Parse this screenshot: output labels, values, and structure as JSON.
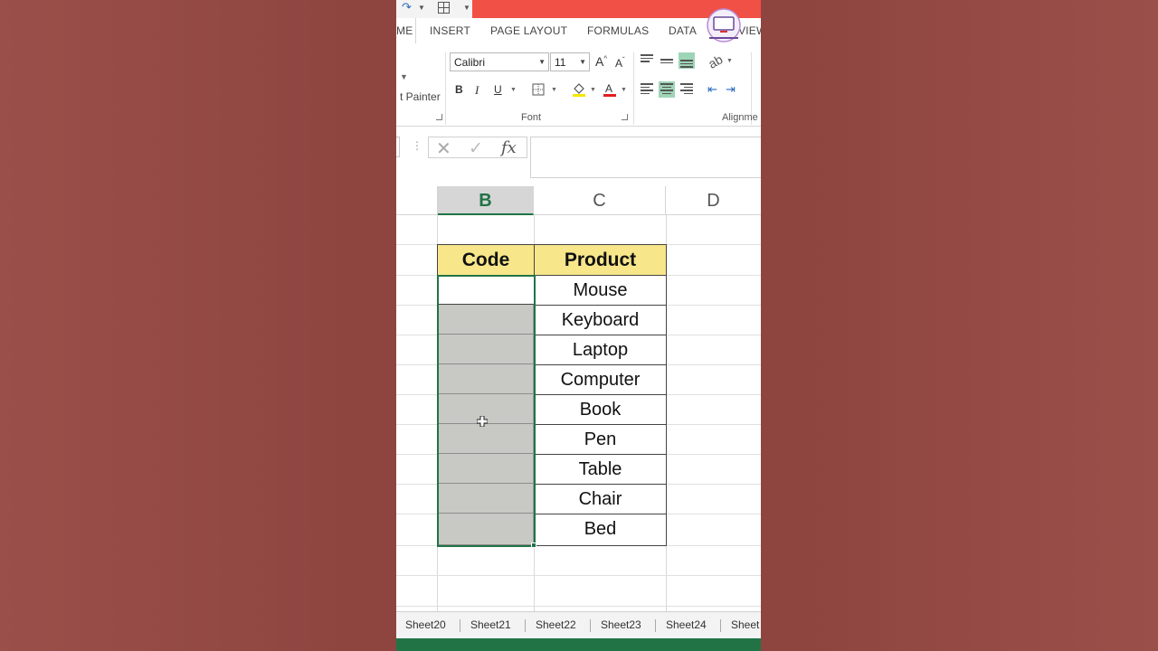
{
  "ribbon_tabs": [
    "ME",
    "INSERT",
    "PAGE LAYOUT",
    "FORMULAS",
    "DATA",
    "REVIEW"
  ],
  "clipboard": {
    "format_painter_label": "t Painter"
  },
  "font": {
    "name": "Calibri",
    "size": "11",
    "bold": "B",
    "italic": "I",
    "underline": "U",
    "grow": "A",
    "shrink": "A",
    "group_label": "Font"
  },
  "alignment": {
    "group_label": "Alignme"
  },
  "formula_bar": {
    "fx": "fx",
    "value": ""
  },
  "columns": [
    "B",
    "C",
    "D"
  ],
  "selected_column": "B",
  "table": {
    "headers": [
      "Code",
      "Product"
    ],
    "products": [
      "Mouse",
      "Keyboard",
      "Laptop",
      "Computer",
      "Book",
      "Pen",
      "Table",
      "Chair",
      "Bed"
    ]
  },
  "sheet_tabs": [
    "Sheet20",
    "Sheet21",
    "Sheet22",
    "Sheet23",
    "Sheet24",
    "Sheet"
  ],
  "colors": {
    "accent_green": "#217346",
    "header_fill": "#f7e68a",
    "selection_fill": "#c8c8c4",
    "title_bar": "#f15046",
    "background": "#8e4540"
  },
  "icons": [
    "redo-icon",
    "table-grid-icon",
    "borders-icon",
    "fill-color-icon",
    "font-color-icon",
    "cancel-icon",
    "enter-icon",
    "insert-function-icon",
    "cell-cursor-icon"
  ]
}
